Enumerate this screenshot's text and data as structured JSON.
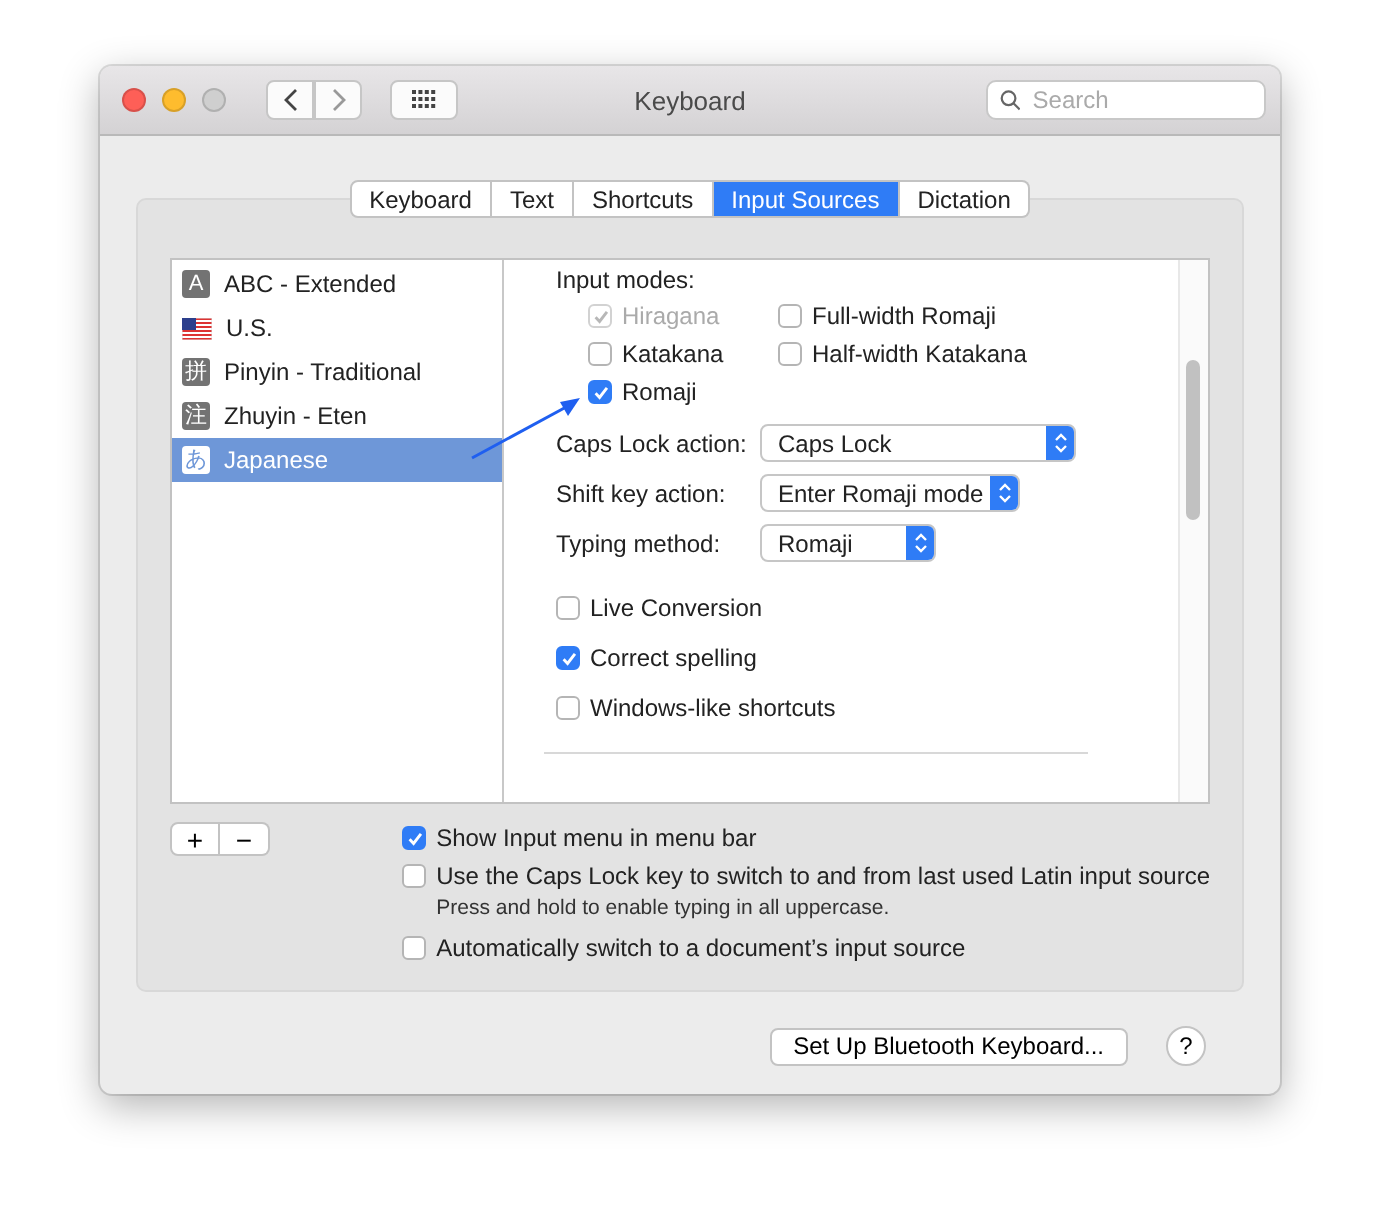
{
  "window": {
    "title": "Keyboard",
    "search": {
      "placeholder": "Search"
    }
  },
  "tabs": [
    {
      "label": "Keyboard",
      "selected": false
    },
    {
      "label": "Text",
      "selected": false
    },
    {
      "label": "Shortcuts",
      "selected": false
    },
    {
      "label": "Input Sources",
      "selected": true
    },
    {
      "label": "Dictation",
      "selected": false
    }
  ],
  "sources": [
    {
      "kind": "glyph",
      "badge": "A",
      "label": "ABC - Extended",
      "selected": false
    },
    {
      "kind": "flag",
      "label": "U.S.",
      "selected": false
    },
    {
      "kind": "glyph",
      "badge": "拼",
      "label": "Pinyin - Traditional",
      "selected": false
    },
    {
      "kind": "glyph",
      "badge": "注",
      "label": "Zhuyin - Eten",
      "selected": false
    },
    {
      "kind": "glyph",
      "badge": "あ",
      "label": "Japanese",
      "selected": true
    }
  ],
  "input_modes": {
    "label": "Input modes:",
    "options": [
      {
        "label": "Hiragana",
        "checked": true,
        "disabled": true
      },
      {
        "label": "Full-width Romaji",
        "checked": false,
        "disabled": false
      },
      {
        "label": "Katakana",
        "checked": false,
        "disabled": false
      },
      {
        "label": "Half-width Katakana",
        "checked": false,
        "disabled": false
      },
      {
        "label": "Romaji",
        "checked": true,
        "disabled": false
      }
    ]
  },
  "popups": [
    {
      "label": "Caps Lock action:",
      "value": "Caps Lock"
    },
    {
      "label": "Shift key action:",
      "value": "Enter Romaji mode"
    },
    {
      "label": "Typing method:",
      "value": "Romaji"
    }
  ],
  "settings": [
    {
      "label": "Live Conversion",
      "checked": false
    },
    {
      "label": "Correct spelling",
      "checked": true
    },
    {
      "label": "Windows-like shortcuts",
      "checked": false
    }
  ],
  "list_buttons": [
    "+",
    "−"
  ],
  "options": [
    {
      "label": "Show Input menu in menu bar",
      "checked": true
    },
    {
      "label": "Use the Caps Lock key to switch to and from last used Latin input source",
      "checked": false,
      "note": "Press and hold to enable typing in all uppercase."
    },
    {
      "label": "Automatically switch to a document’s input source",
      "checked": false
    }
  ],
  "footer": {
    "button": "Set Up Bluetooth Keyboard...",
    "help": "?"
  }
}
